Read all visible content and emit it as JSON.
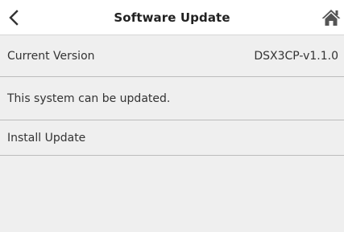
{
  "header": {
    "title": "Software Update",
    "back_icon": "chevron-left-icon",
    "home_icon": "home-icon"
  },
  "rows": [
    {
      "label": "Current Version",
      "value": "DSX3CP-v1.1.0"
    },
    {
      "label": "This system can be updated."
    },
    {
      "label": "Install Update"
    }
  ],
  "colors": {
    "header_bg": "#ffffff",
    "list_bg": "#efefef",
    "divider": "#bcbcbc",
    "icon": "#555555"
  }
}
